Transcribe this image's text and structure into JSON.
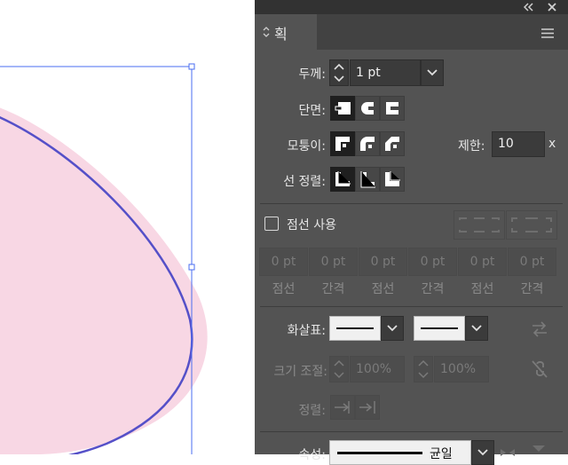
{
  "panel": {
    "title": "획",
    "menu_icon": "hamburger-menu-icon",
    "collapse_icon": "double-chevron-left-icon",
    "close_icon": "close-icon"
  },
  "weight": {
    "label": "두께:",
    "value": "1 pt"
  },
  "cap": {
    "label": "단면:",
    "selected": "butt-cap"
  },
  "corner": {
    "label": "모퉁이:",
    "selected": "miter-join",
    "limit_label": "제한:",
    "limit_value": "10",
    "limit_unit": "x"
  },
  "align": {
    "label": "선 정렬:",
    "selected": "align-center"
  },
  "dashed": {
    "label": "점선 사용",
    "checked": false
  },
  "dash_fields": [
    {
      "value": "0 pt",
      "label": "점선"
    },
    {
      "value": "0 pt",
      "label": "간격"
    },
    {
      "value": "0 pt",
      "label": "점선"
    },
    {
      "value": "0 pt",
      "label": "간격"
    },
    {
      "value": "0 pt",
      "label": "점선"
    },
    {
      "value": "0 pt",
      "label": "간격"
    }
  ],
  "arrowheads": {
    "label": "화살표:"
  },
  "scale": {
    "label": "크기 조절:",
    "start": "100%",
    "end": "100%"
  },
  "arrow_align": {
    "label": "정렬:"
  },
  "profile": {
    "label": "속성:",
    "value": "균일"
  },
  "colors": {
    "accent_selection": "#4444ee",
    "shape_fill": "#f8d7e4",
    "shape_stroke": "#5550c8",
    "panel_bg": "#535353"
  }
}
